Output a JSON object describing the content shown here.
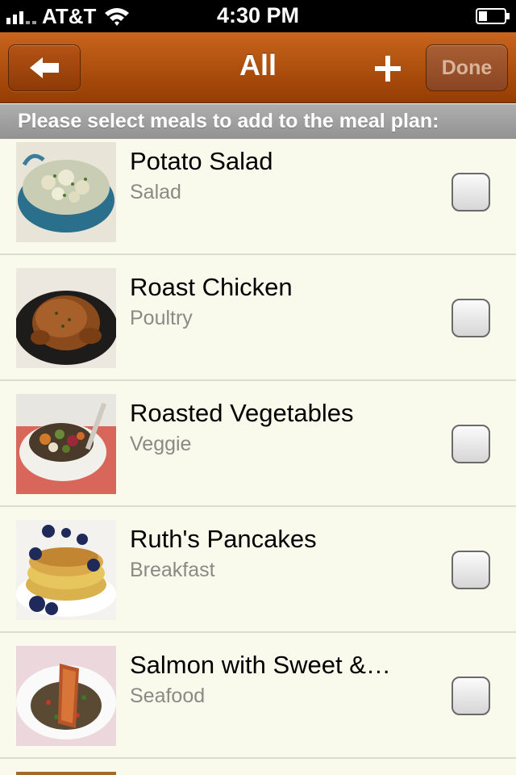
{
  "status_bar": {
    "carrier": "AT&T",
    "time": "4:30 PM"
  },
  "nav": {
    "title": "All",
    "add_label": "+",
    "done_label": "Done"
  },
  "section_header": "Please select meals to add to the meal plan:",
  "meals": [
    {
      "name": "Potato Salad",
      "category": "Salad",
      "checked": false
    },
    {
      "name": "Roast Chicken",
      "category": "Poultry",
      "checked": false
    },
    {
      "name": "Roasted Vegetables",
      "category": "Veggie",
      "checked": false
    },
    {
      "name": "Ruth's Pancakes",
      "category": "Breakfast",
      "checked": false
    },
    {
      "name": "Salmon with Sweet &…",
      "category": "Seafood",
      "checked": false
    }
  ],
  "colors": {
    "nav_brown": "#b1520f",
    "list_background": "#f9f9ec",
    "header_gray": "#a0a0a0"
  },
  "icons": {
    "back": "back-arrow-icon",
    "wifi": "wifi-icon",
    "battery": "battery-icon",
    "signal": "signal-icon"
  }
}
